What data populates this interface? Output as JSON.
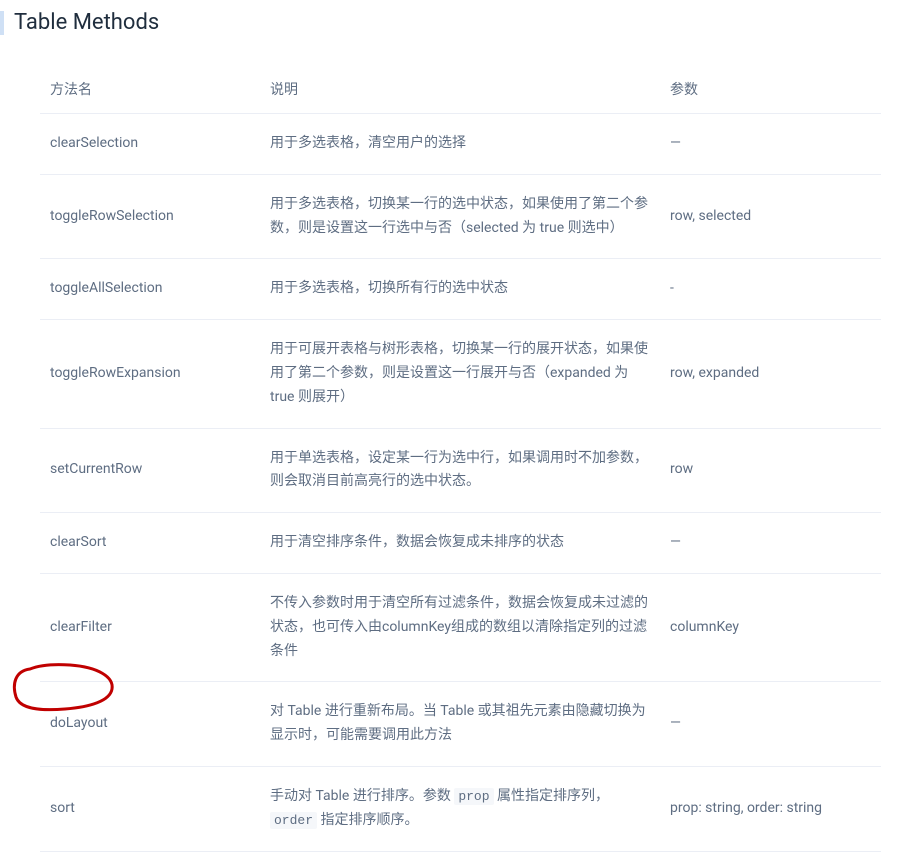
{
  "heading": "Table Methods",
  "columns": {
    "name": "方法名",
    "desc": "说明",
    "params": "参数"
  },
  "rows": [
    {
      "name": "clearSelection",
      "desc": "用于多选表格，清空用户的选择",
      "params": "—"
    },
    {
      "name": "toggleRowSelection",
      "desc": "用于多选表格，切换某一行的选中状态，如果使用了第二个参数，则是设置这一行选中与否（selected 为 true 则选中）",
      "params": "row, selected"
    },
    {
      "name": "toggleAllSelection",
      "desc": "用于多选表格，切换所有行的选中状态",
      "params": "-"
    },
    {
      "name": "toggleRowExpansion",
      "desc": "用于可展开表格与树形表格，切换某一行的展开状态，如果使用了第二个参数，则是设置这一行展开与否（expanded 为 true 则展开）",
      "params": "row, expanded"
    },
    {
      "name": "setCurrentRow",
      "desc": "用于单选表格，设定某一行为选中行，如果调用时不加参数，则会取消目前高亮行的选中状态。",
      "params": "row"
    },
    {
      "name": "clearSort",
      "desc": "用于清空排序条件，数据会恢复成未排序的状态",
      "params": "—"
    },
    {
      "name": "clearFilter",
      "desc": "不传入参数时用于清空所有过滤条件，数据会恢复成未过滤的状态，也可传入由columnKey组成的数组以清除指定列的过滤条件",
      "params": "columnKey"
    },
    {
      "name": "doLayout",
      "desc": "对 Table 进行重新布局。当 Table 或其祖先元素由隐藏切换为显示时，可能需要调用此方法",
      "params": "—"
    },
    {
      "name": "sort",
      "desc_parts": [
        "手动对 Table 进行排序。参数 ",
        "prop",
        " 属性指定排序列，",
        "order",
        " 指定排序顺序。"
      ],
      "params": "prop: string, order: string"
    }
  ]
}
